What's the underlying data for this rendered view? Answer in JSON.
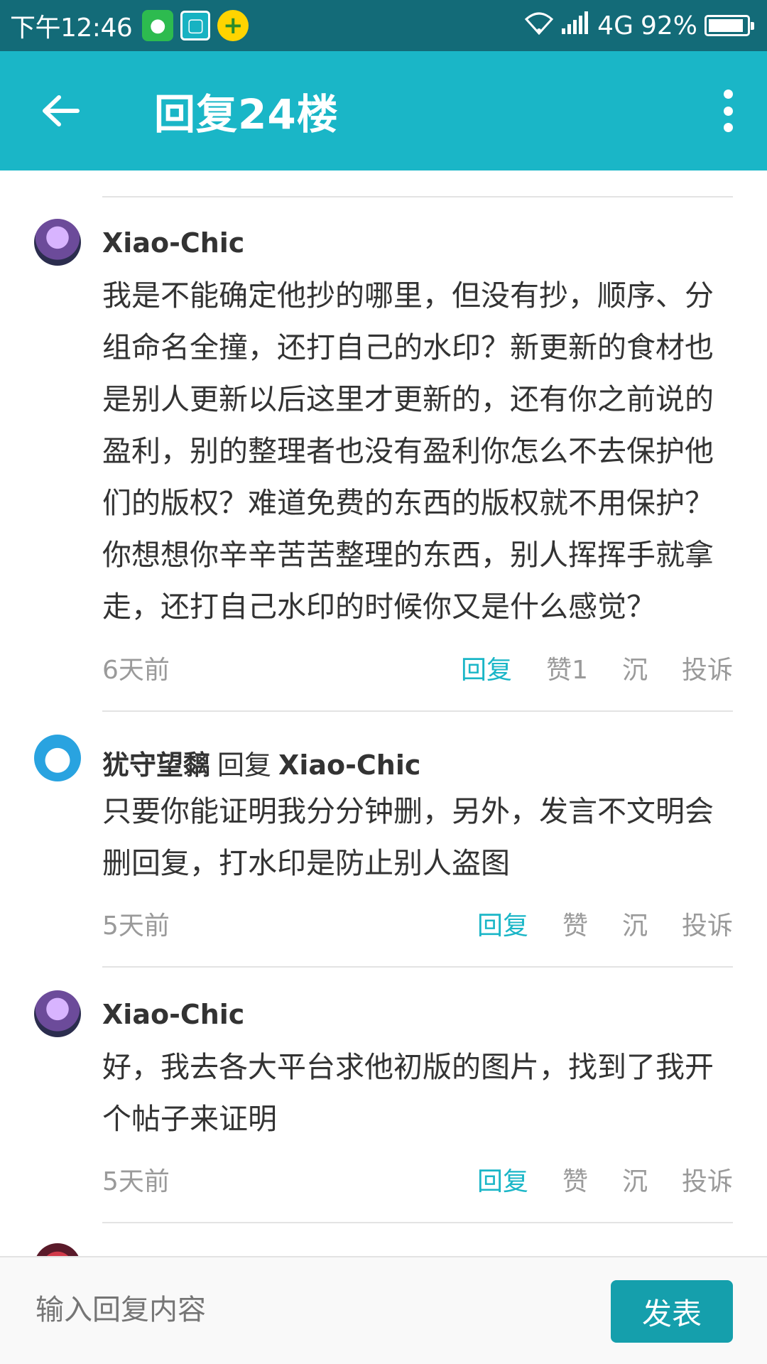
{
  "status_bar": {
    "time": "下午12:46",
    "network": "4G",
    "battery_percent_label": "92%",
    "battery_level": 0.92,
    "apps": [
      "wechat-icon",
      "scan-icon",
      "plus-icon"
    ]
  },
  "app_bar": {
    "title": "回复24楼",
    "back_icon": "arrow-left-icon",
    "more_icon": "more-vertical-icon"
  },
  "comments": [
    {
      "author": "Xiao-Chic",
      "reply_to": "",
      "text": "我是不能确定他抄的哪里，但没有抄，顺序、分组命名全撞，还打自己的水印？新更新的食材也是别人更新以后这里才更新的，还有你之前说的盈利，别的整理者也没有盈利你怎么不去保护他们的版权？难道免费的东西的版权就不用保护？你想想你辛辛苦苦整理的东西，别人挥挥手就拿走，还打自己水印的时候你又是什么感觉？",
      "time": "6天前",
      "reply_label": "回复",
      "like_label": "赞1",
      "sink_label": "沉",
      "report_label": "投诉"
    },
    {
      "author": "犹守望黐",
      "reply_word": "回复",
      "reply_to": "Xiao-Chic",
      "text": "只要你能证明我分分钟删，另外，发言不文明会删回复，打水印是防止别人盗图",
      "time": "5天前",
      "reply_label": "回复",
      "like_label": "赞",
      "sink_label": "沉",
      "report_label": "投诉"
    },
    {
      "author": "Xiao-Chic",
      "reply_to": "",
      "text": "好，我去各大平台求他初版的图片，找到了我开个帖子来证明",
      "time": "5天前",
      "reply_label": "回复",
      "like_label": "赞",
      "sink_label": "沉",
      "report_label": "投诉"
    }
  ],
  "bottom_bar": {
    "input_placeholder": "输入回复内容",
    "send_label": "发表"
  },
  "colors": {
    "status_bar": "#136b78",
    "app_bar": "#1ab6c7",
    "accent": "#1ab6c7",
    "send_button": "#159fac"
  }
}
